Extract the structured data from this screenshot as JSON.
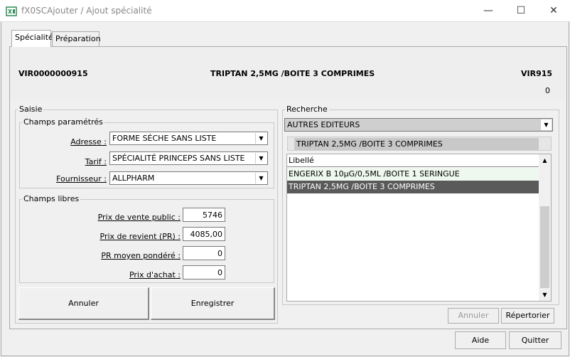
{
  "window": {
    "title": "fX0SCAjouter / Ajout spécialité",
    "minimize": "—",
    "maximize": "☐",
    "close": "✕"
  },
  "tabs": [
    {
      "label": "Spécialité"
    },
    {
      "label": "Préparation"
    }
  ],
  "header": {
    "code": "VIR0000000915",
    "product": "TRIPTAN 2,5MG /BOITE 3 COMPRIMES",
    "short_code": "VIR915",
    "count": "0"
  },
  "saisie": {
    "title": "Saisie",
    "champs_parametres": {
      "title": "Champs paramétrés",
      "adresse_label": "Adresse :",
      "adresse_value": "FORME SÉCHE SANS LISTE",
      "tarif_label": "Tarif :",
      "tarif_value": "SPÉCIALITÉ PRINCEPS SANS LISTE",
      "fournisseur_label": "Fournisseur :",
      "fournisseur_value": "ALLPHARM"
    },
    "champs_libres": {
      "title": "Champs libres",
      "prix_vente_label": "Prix de vente public :",
      "prix_vente_value": "5746",
      "prix_revient_label": "Prix de revient (PR) :",
      "prix_revient_value": "4085,00",
      "pr_moyen_label": "PR moyen pondéré :",
      "pr_moyen_value": "0",
      "prix_achat_label": "Prix d'achat :",
      "prix_achat_value": "0"
    },
    "annuler": "Annuler",
    "enregistrer": "Enregistrer"
  },
  "recherche": {
    "title": "Recherche",
    "editor_value": "AUTRES EDITEURS",
    "search_value": "TRIPTAN 2,5MG /BOITE 3 COMPRIMES",
    "column_header": "Libellé",
    "rows": [
      {
        "label": "ENGERIX B 10µG/0,5ML /BOITE 1 SERINGUE"
      },
      {
        "label": "TRIPTAN 2,5MG /BOITE 3 COMPRIMES"
      }
    ],
    "annuler": "Annuler",
    "repertorier": "Répertorier"
  },
  "footer": {
    "aide": "Aide",
    "quitter": "Quitter"
  }
}
